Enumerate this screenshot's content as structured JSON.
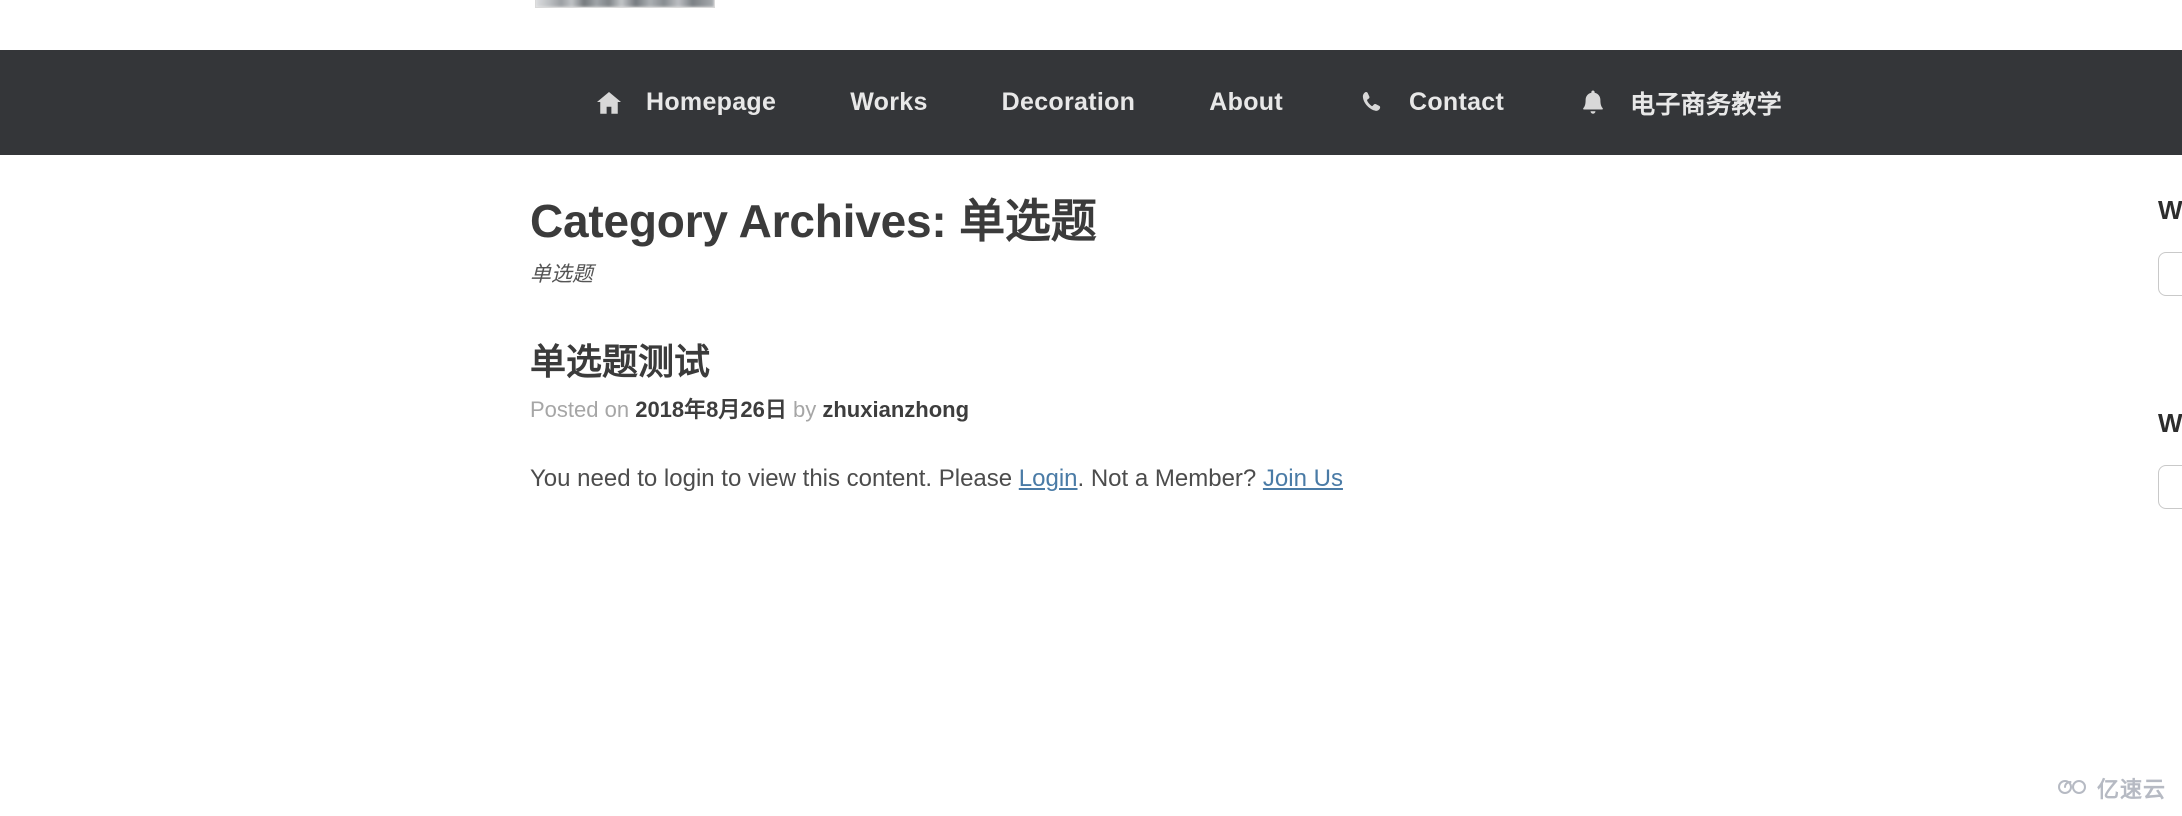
{
  "banner": {
    "alt": "cut-off-header-image"
  },
  "nav": {
    "items": [
      {
        "icon": "home-icon",
        "label": "Homepage"
      },
      {
        "icon": "",
        "label": "Works"
      },
      {
        "icon": "",
        "label": "Decoration"
      },
      {
        "icon": "",
        "label": "About"
      },
      {
        "icon": "phone-icon",
        "label": "Contact"
      },
      {
        "icon": "bell-icon",
        "label": "电子商务教学"
      }
    ],
    "background_color": "#343639",
    "text_color": "#e8e8e8"
  },
  "archive": {
    "title": "Category Archives: 单选题",
    "description": "单选题"
  },
  "post": {
    "title": "单选题测试",
    "meta_posted_on": "Posted on",
    "meta_date": "2018年8月26日",
    "meta_by": "by",
    "meta_author": "zhuxianzhong",
    "body_prefix": "You need to login to view this content. Please ",
    "login_link": "Login",
    "body_middle": ". Not a Member? ",
    "join_link": "Join Us",
    "link_color": "#4a7ba6"
  },
  "sidebar": {
    "widgets": [
      {
        "title": "W"
      },
      {
        "title": "W"
      }
    ]
  },
  "watermark": {
    "text": "亿速云"
  }
}
